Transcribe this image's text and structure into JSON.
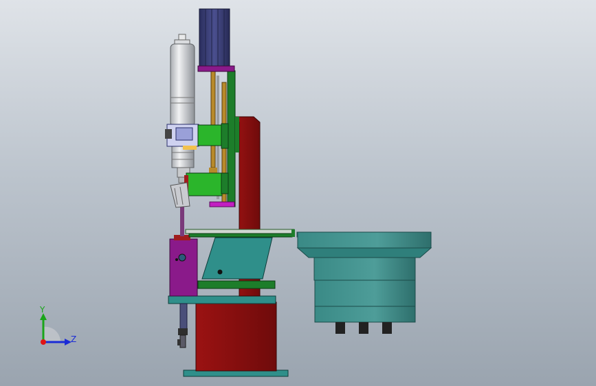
{
  "triad": {
    "y_label": "Y",
    "z_label": "Z",
    "colors": {
      "y": "#1aa51a",
      "z": "#1a2bd6",
      "x": "#e01515"
    }
  },
  "colors": {
    "background_top": "#dfe3e8",
    "background_bottom": "#9aa4af",
    "frame_red": "#8c0f0f",
    "plate_green": "#1d7d2a",
    "bright_green": "#2bb52b",
    "teal": "#2f8f8a",
    "purple": "#8a1a8a",
    "motor_navy": "#3b3f78",
    "bowl_teal": "#3f8f8c",
    "cylinder_grey": "#cfd2d6"
  }
}
